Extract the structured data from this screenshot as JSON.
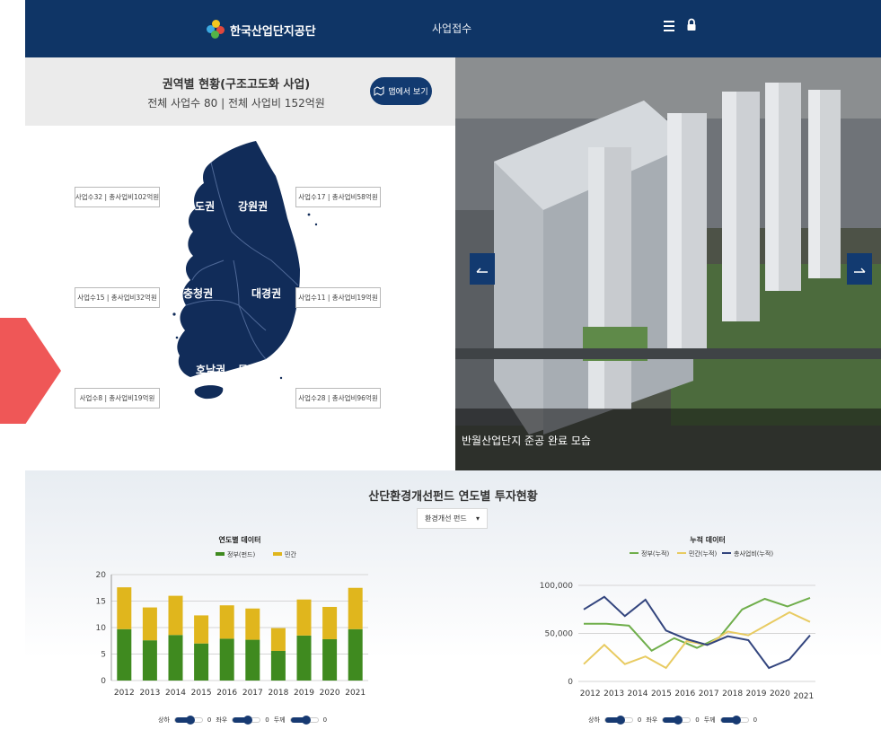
{
  "header": {
    "logo_text": "한국산업단지공단",
    "nav_center": "사업접수",
    "menu_icon": "menu-icon",
    "lock_icon": "lock-icon",
    "bg_color": "#0f3566"
  },
  "region": {
    "title": "권역별 현황(구조고도화 사업)",
    "summary": "전체 사업수 80 | 전체 사업비 152억원",
    "map_button": "맵에서 보기",
    "regions": [
      {
        "name": "수도권",
        "stat": "사업수32 | 총사업비102억원"
      },
      {
        "name": "강원권",
        "stat": "사업수17 | 총사업비58억원"
      },
      {
        "name": "충청권",
        "stat": "사업수15 | 총사업비32억원"
      },
      {
        "name": "대경권",
        "stat": "사업수11 | 총사업비19억원"
      },
      {
        "name": "호남권",
        "stat": "사업수8 | 총사업비19억원"
      },
      {
        "name": "동남권",
        "stat": "사업수28 | 총사업비96억원"
      }
    ],
    "map_color": "#112c59"
  },
  "photo": {
    "caption": "반월산업단지 준공 완료 모습",
    "prev_icon": "arrow-left-icon",
    "next_icon": "arrow-right-icon"
  },
  "fund": {
    "title": "산단환경개선펀드 연도별 투자현황",
    "select_value": "환경개선 펀드",
    "select_arrow": "▾"
  },
  "sliders": {
    "left": [
      {
        "label": "상하",
        "value": "0"
      },
      {
        "label": "좌우",
        "value": "0"
      },
      {
        "label": "두께",
        "value": "0"
      }
    ],
    "right": [
      {
        "label": "상하",
        "value": "0"
      },
      {
        "label": "좌우",
        "value": "0"
      },
      {
        "label": "두께",
        "value": "0"
      }
    ]
  },
  "chart_data": [
    {
      "type": "bar",
      "title": "연도별 데이터",
      "categories": [
        "2012",
        "2013",
        "2014",
        "2015",
        "2016",
        "2017",
        "2018",
        "2019",
        "2020",
        "2021"
      ],
      "series": [
        {
          "name": "정부(펀드)",
          "color": "#3f8a1f",
          "values": [
            9.7,
            7.6,
            8.6,
            7.0,
            7.9,
            7.7,
            5.6,
            8.5,
            7.8,
            9.7
          ]
        },
        {
          "name": "민간",
          "color": "#e0b61d",
          "values": [
            7.9,
            6.2,
            7.4,
            5.3,
            6.3,
            5.9,
            4.3,
            6.8,
            6.1,
            7.8
          ]
        }
      ],
      "stacked": true,
      "ylim": [
        0,
        20
      ],
      "yticks": [
        "0",
        "5",
        "10",
        "15",
        "20"
      ],
      "grid": true,
      "legend": "top"
    },
    {
      "type": "line",
      "title": "누적 데이터",
      "categories": [
        "2012",
        "2013",
        "2014",
        "2015",
        "2016",
        "2017",
        "2018",
        "2019",
        "2020",
        "2021"
      ],
      "series": [
        {
          "name": "정부(누적)",
          "color": "#6fae4b",
          "values": [
            60000,
            60000,
            58000,
            32000,
            45000,
            35000,
            46000,
            75000,
            86000,
            78000,
            87000
          ]
        },
        {
          "name": "민간(누적)",
          "color": "#e8cb62",
          "values": [
            18000,
            38000,
            18000,
            26000,
            14000,
            42000,
            38000,
            52000,
            48000,
            60000,
            72000,
            62000
          ]
        },
        {
          "name": "총사업비(누적)",
          "color": "#33457e",
          "values": [
            75000,
            88000,
            68000,
            85000,
            53000,
            44000,
            38000,
            47000,
            43000,
            14000,
            23000,
            48000
          ]
        }
      ],
      "ylim": [
        0,
        100000
      ],
      "yticks": [
        "0",
        "50,000",
        "100,000"
      ],
      "grid": true,
      "legend": "top"
    }
  ]
}
